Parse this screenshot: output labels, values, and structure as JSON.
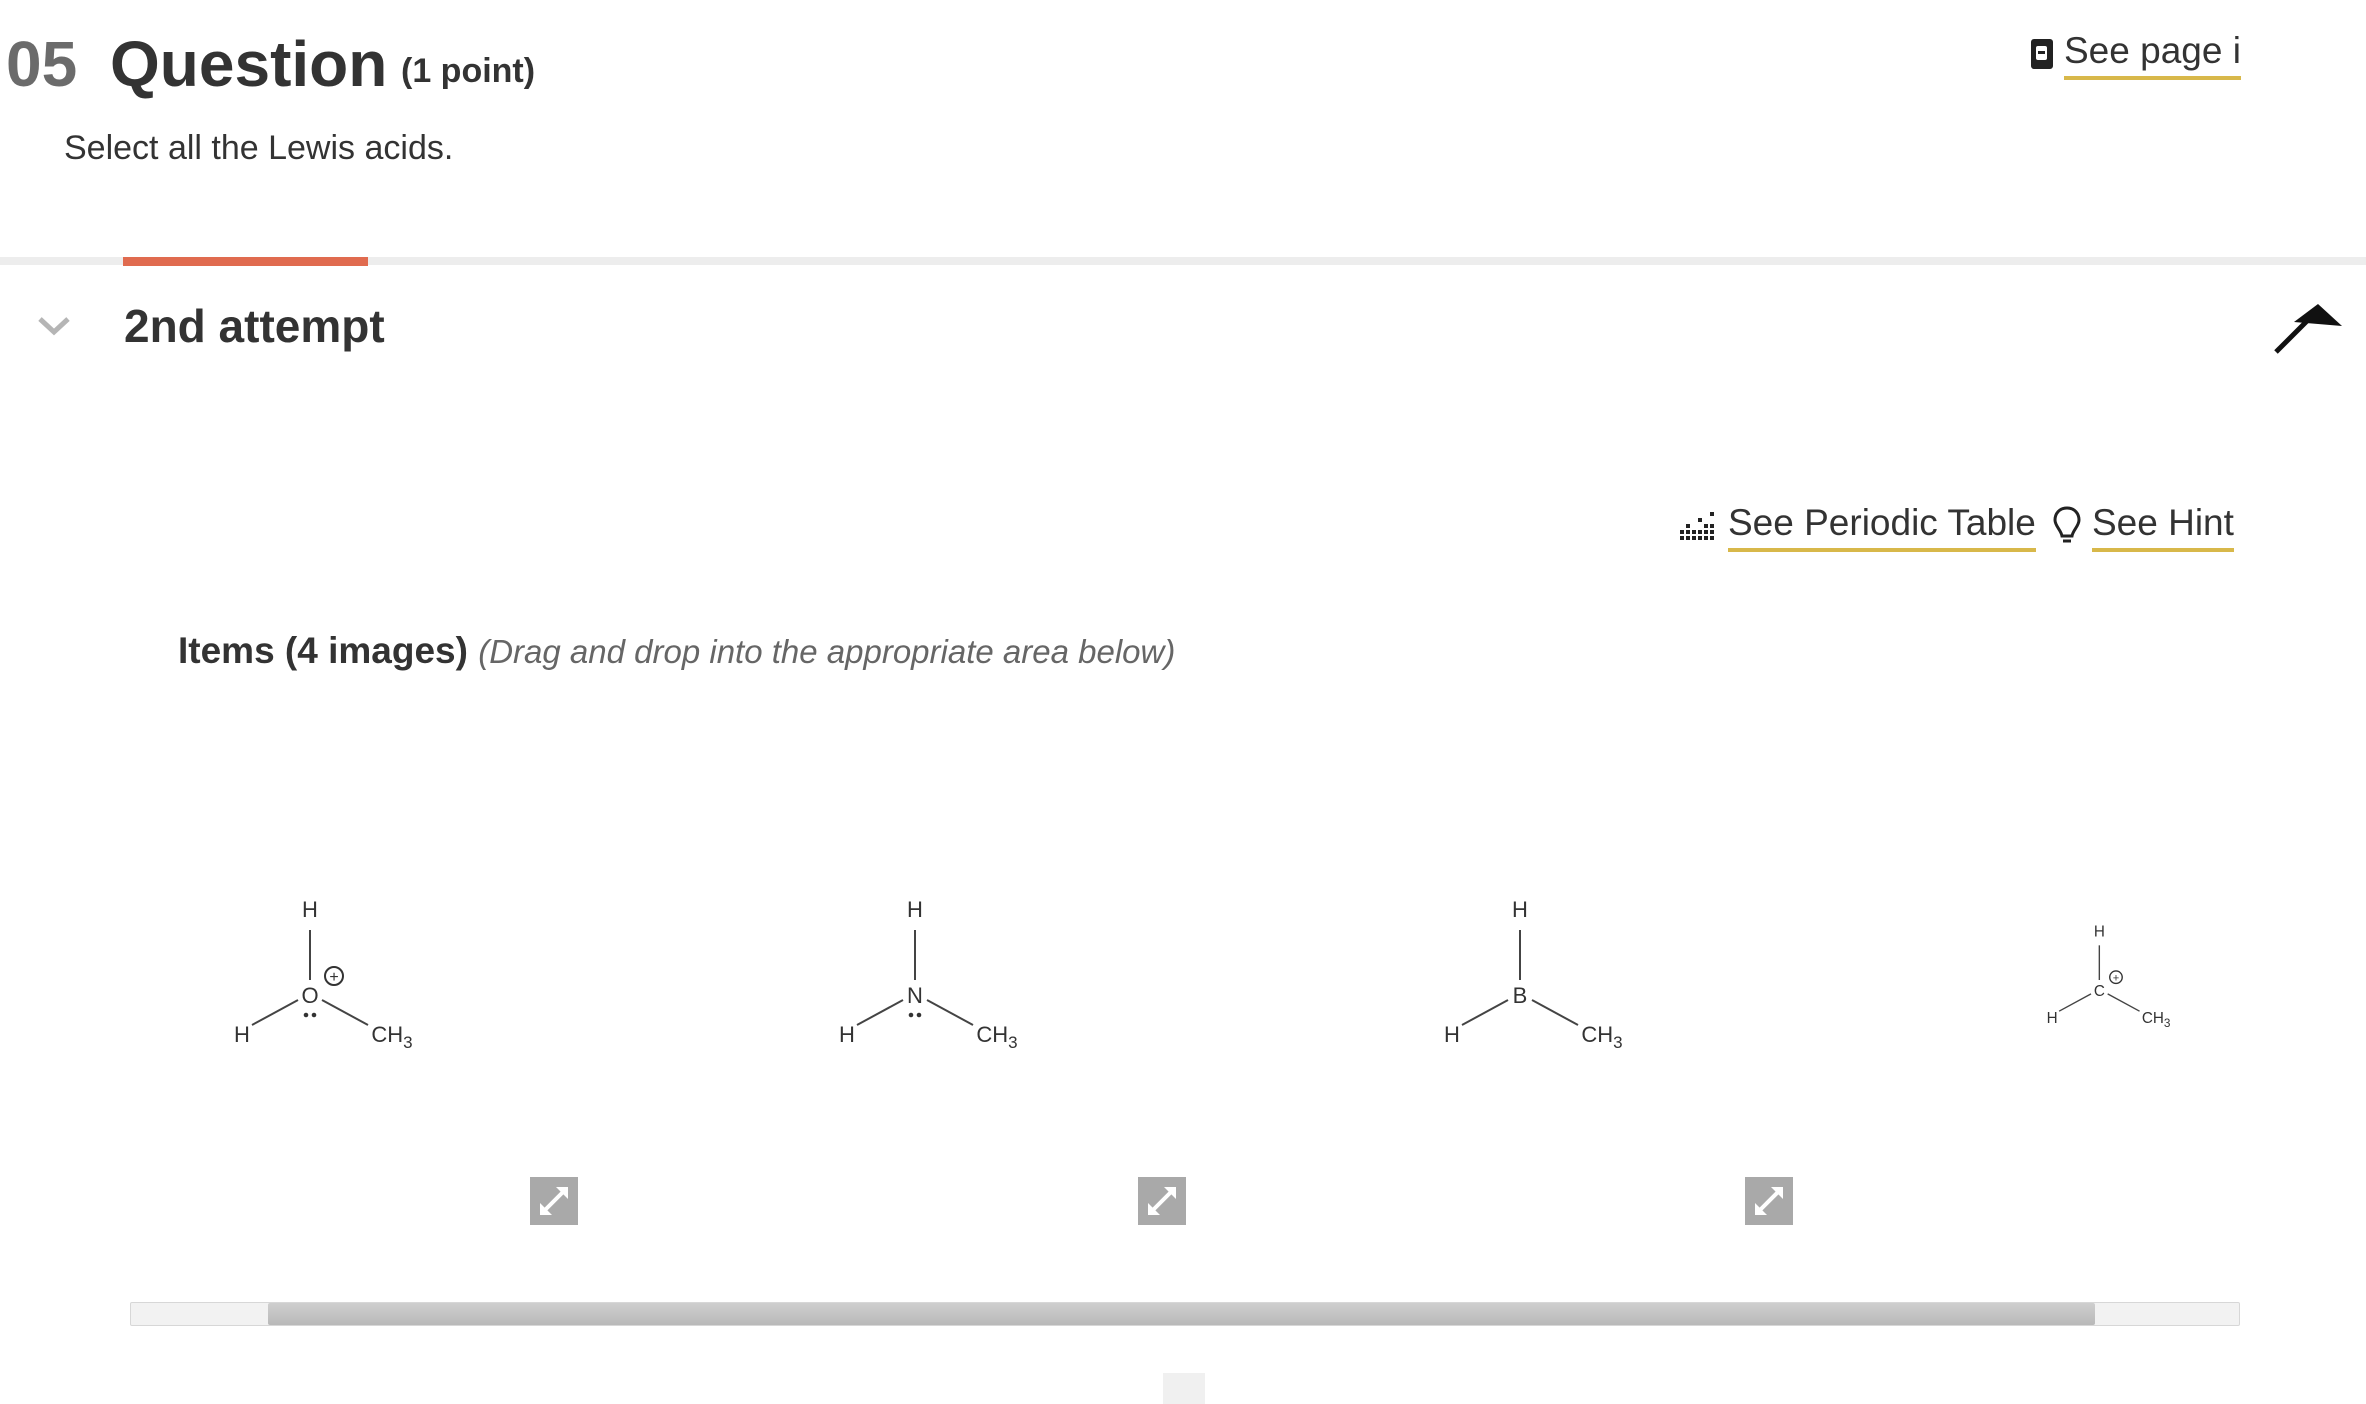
{
  "question": {
    "number": "05",
    "title": "Question",
    "points": "(1 point)",
    "prompt": "Select all the Lewis acids."
  },
  "header_links": {
    "see_page": "See page i"
  },
  "attempt": {
    "label": "2nd attempt"
  },
  "tools": {
    "periodic_table": "See Periodic Table",
    "hint": "See Hint"
  },
  "items": {
    "heading": "Items (4 images)",
    "instruction": "(Drag and drop into the appropriate area below)",
    "molecules": [
      {
        "top": "H",
        "left": "H",
        "center": "O",
        "right": "CH3",
        "charge": "+",
        "lone_pair": true
      },
      {
        "top": "H",
        "left": "H",
        "center": "N",
        "right": "CH3",
        "charge": "",
        "lone_pair": true
      },
      {
        "top": "H",
        "left": "H",
        "center": "B",
        "right": "CH3",
        "charge": "",
        "lone_pair": false
      },
      {
        "top": "H",
        "left": "H",
        "center": "C",
        "right": "CH3",
        "charge": "+",
        "lone_pair": false
      }
    ]
  },
  "colors": {
    "accent_tab": "#e06b4f",
    "link_underline": "#d8b84a",
    "text": "#333333",
    "muted": "#6b6b6b"
  },
  "icons": [
    "book-icon",
    "chevron-down-icon",
    "pin-icon",
    "periodic-table-icon",
    "lightbulb-icon",
    "expand-icon"
  ]
}
